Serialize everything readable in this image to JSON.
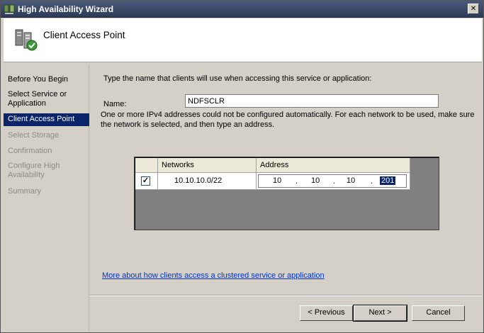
{
  "window": {
    "title": "High Availability Wizard",
    "close_glyph": "✕"
  },
  "header": {
    "title": "Client Access Point",
    "icon": "server-cluster-icon"
  },
  "steps": [
    {
      "label": "Before You Begin",
      "state": "normal"
    },
    {
      "label": "Select Service or Application",
      "state": "normal"
    },
    {
      "label": "Client Access Point",
      "state": "active"
    },
    {
      "label": "Select Storage",
      "state": "disabled"
    },
    {
      "label": "Confirmation",
      "state": "disabled"
    },
    {
      "label": "Configure High Availability",
      "state": "disabled"
    },
    {
      "label": "Summary",
      "state": "disabled"
    }
  ],
  "main": {
    "instruction": "Type the name that clients will use when accessing this service or application:",
    "name_label": "Name:",
    "name_value": "NDFSCLR",
    "warning": "One or more IPv4 addresses could not be configured automatically.  For each network to be used, make sure the network is selected, and then type an address.",
    "grid": {
      "columns": [
        "Networks",
        "Address"
      ],
      "rows": [
        {
          "checked": true,
          "check_glyph": "✓",
          "network": "10.10.10.0/22",
          "address": [
            "10",
            "10",
            "10",
            "201"
          ]
        }
      ]
    },
    "more_link": "More about how clients access a clustered service or application"
  },
  "buttons": {
    "previous": "< Previous",
    "next": "Next >",
    "cancel": "Cancel"
  },
  "colors": {
    "active_step": "#0a246a",
    "link": "#0033cc",
    "grid_empty": "#808080"
  }
}
